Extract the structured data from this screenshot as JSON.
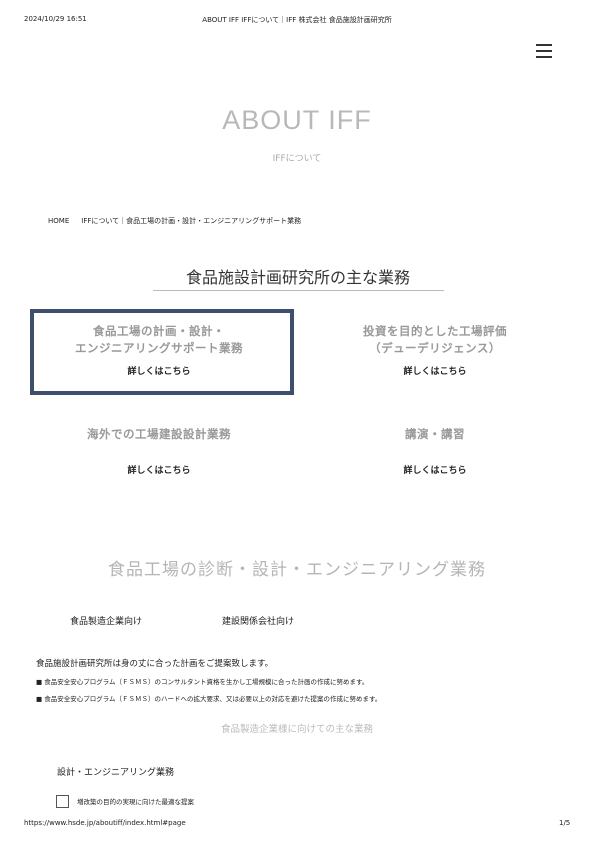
{
  "print_header": {
    "datetime": "2024/10/29 16:51",
    "title": "ABOUT IFF IFFについて｜IFF 株式会社 食品施設計画研究所"
  },
  "hero": {
    "title": "ABOUT IFF",
    "subtitle": "IFFについて"
  },
  "breadcrumb": {
    "home": "HOME",
    "items": [
      "IFFについて",
      "食品工場の計画・設計・エンジニアリングサポート業務"
    ]
  },
  "services": {
    "title": "食品施設計画研究所の主な業務",
    "cards": [
      {
        "title_line1": "食品工場の計画・設計・",
        "title_line2": "エンジニアリングサポート業務",
        "link": "詳しくはこちら"
      },
      {
        "title_line1": "投資を目的とした工場評価",
        "title_line2": "（デューデリジェンス）",
        "link": "詳しくはこちら"
      },
      {
        "title_line1": "海外での工場建設設計業務",
        "title_line2": "",
        "link": "詳しくはこちら"
      },
      {
        "title_line1": "講演・講習",
        "title_line2": "",
        "link": "詳しくはこちら"
      }
    ]
  },
  "diagnosis": {
    "title": "食品工場の診断・設計・エンジニアリング業務",
    "tabs": [
      "食品製造企業向け",
      "建設関係会社向け"
    ],
    "intro": "食品施設計画研究所は身の丈に合った計画をご提案致します。",
    "bullets": [
      "■ 食品安全安心プログラム（ＦＳＭＳ）のコンサルタント資格を生かし工場規模に合った計画の作成に努めます。",
      "■ 食品安全安心プログラム（ＦＳＭＳ）のハードへの拡大要求、又は必要以上の対応を避けた提案の作成に努めます。"
    ],
    "sub_heading": "食品製造企業様に向けての主な業務",
    "design_label": "設計・エンジニアリング業務",
    "checkbox_label": "増改築の目的の実現に向けた最適な提案"
  },
  "print_footer": {
    "url": "https://www.hsde.jp/aboutiff/index.html#page",
    "page": "1/5"
  },
  "colors": {
    "active_border": "#3d4f6d",
    "muted_text": "#b5b5b5"
  }
}
